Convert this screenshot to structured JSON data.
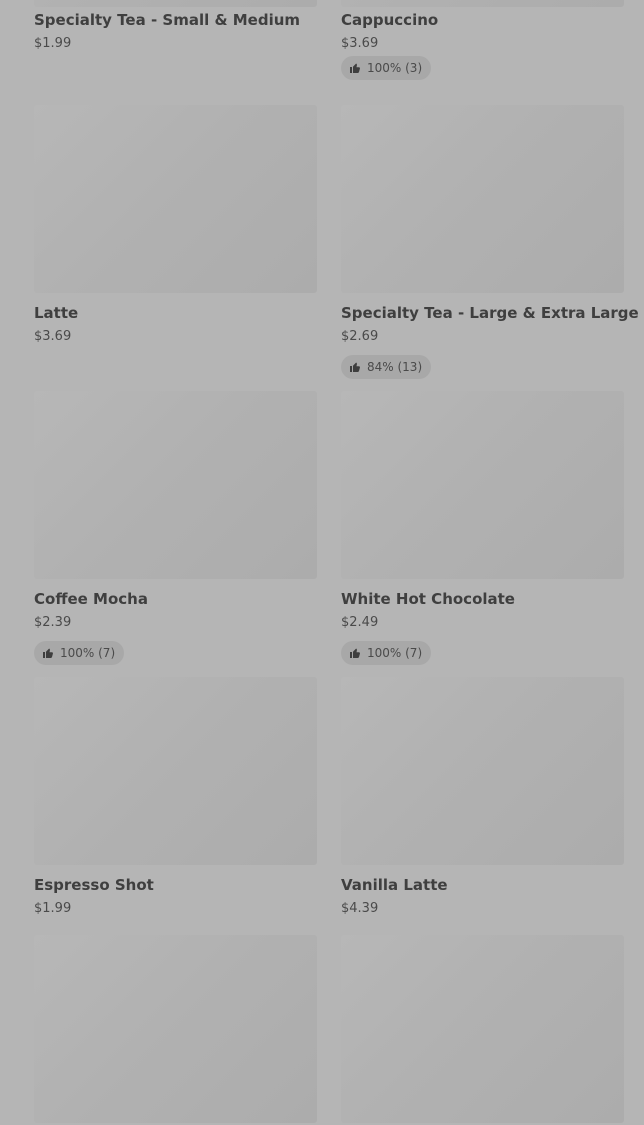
{
  "colors": {
    "background": "#b5b5b5",
    "image_placeholder": "#afafaf",
    "text_primary": "#3f3f3f",
    "text_secondary": "#4a4a4a",
    "badge_bg": "#a8a8a8"
  },
  "items": [
    {
      "name": "Specialty Tea - Small & Medium",
      "price": "$1.99",
      "rating": ""
    },
    {
      "name": "Cappuccino",
      "price": "$3.69",
      "rating": "100% (3)"
    },
    {
      "name": "Latte",
      "price": "$3.69",
      "rating": ""
    },
    {
      "name": "Specialty Tea - Large & Extra Large",
      "price": "$2.69",
      "rating": "84% (13)"
    },
    {
      "name": "Coffee Mocha",
      "price": "$2.39",
      "rating": "100% (7)"
    },
    {
      "name": "White Hot Chocolate",
      "price": "$2.49",
      "rating": "100% (7)"
    },
    {
      "name": "Espresso Shot",
      "price": "$1.99",
      "rating": ""
    },
    {
      "name": "Vanilla Latte",
      "price": "$4.39",
      "rating": ""
    }
  ],
  "icons": {
    "rating": "thumbs-up-icon"
  }
}
